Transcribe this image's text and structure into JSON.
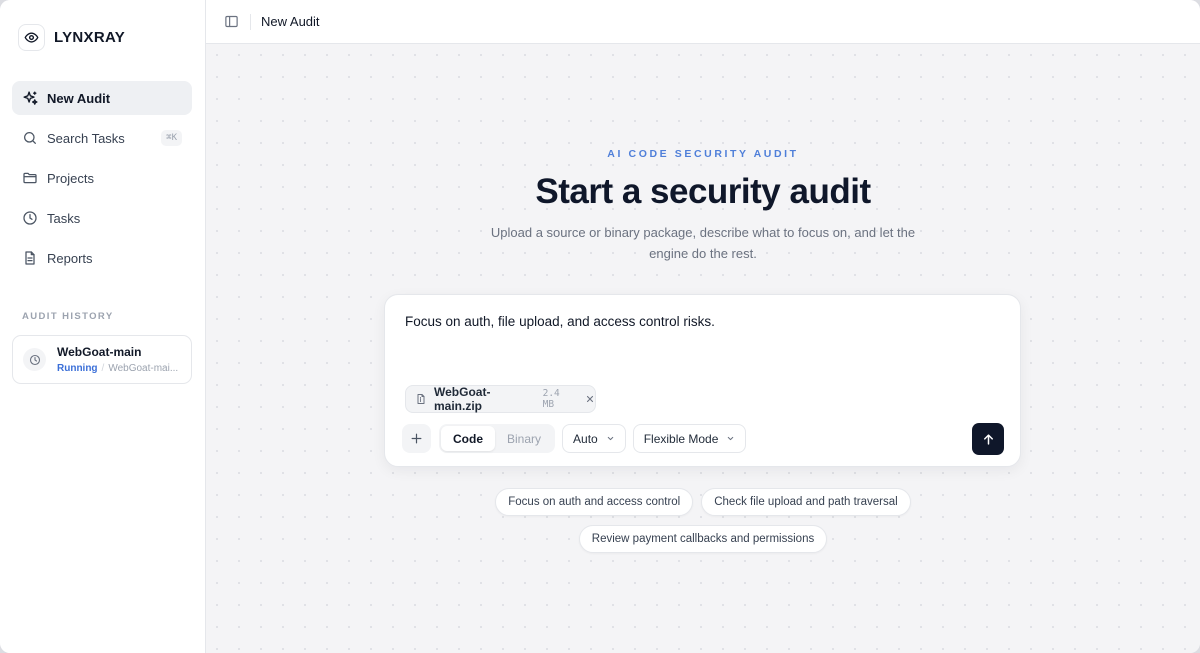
{
  "brand": {
    "name": "LYNXRAY",
    "icon": "eye-icon"
  },
  "nav": {
    "items": [
      {
        "label": "New Audit",
        "icon": "sparkle-icon",
        "active": true
      },
      {
        "label": "Search Tasks",
        "icon": "search-icon",
        "shortcut": "⌘K"
      },
      {
        "label": "Projects",
        "icon": "folder-icon"
      },
      {
        "label": "Tasks",
        "icon": "clock-icon"
      },
      {
        "label": "Reports",
        "icon": "document-icon"
      }
    ]
  },
  "history": {
    "title": "AUDIT HISTORY",
    "items": [
      {
        "name": "WebGoat-main",
        "status": "Running",
        "detail": "WebGoat-mai..."
      }
    ]
  },
  "topbar": {
    "title": "New Audit"
  },
  "hero": {
    "eyebrow": "AI CODE SECURITY AUDIT",
    "title": "Start a security audit",
    "subtitle": "Upload a source or binary package, describe what to focus on, and let the engine do the rest."
  },
  "composer": {
    "prompt": "Focus on auth, file upload, and access control risks.",
    "file": {
      "name": "WebGoat-main.zip",
      "size": "2.4 MB"
    },
    "modes": [
      {
        "label": "Code",
        "active": true
      },
      {
        "label": "Binary",
        "active": false
      }
    ],
    "model_select": "Auto",
    "mode_select": "Flexible Mode"
  },
  "suggestions": [
    "Focus on auth and access control",
    "Check file upload and path traversal",
    "Review payment callbacks and permissions"
  ],
  "colors": {
    "accent": "#4f7fd9",
    "primary_dark": "#0f172a",
    "status_running": "#3b6fd8"
  }
}
